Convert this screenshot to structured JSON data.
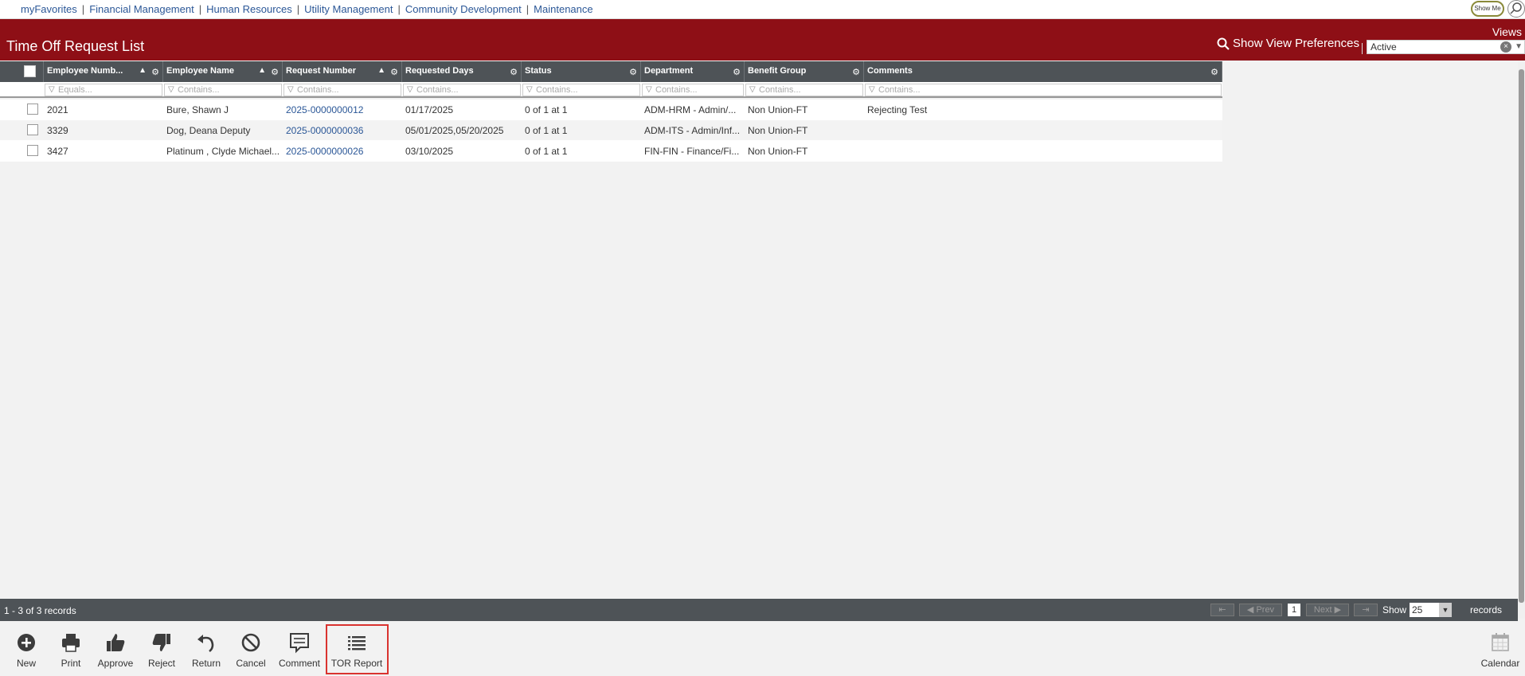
{
  "topnav": {
    "links": [
      "myFavorites",
      "Financial Management",
      "Human Resources",
      "Utility Management",
      "Community Development",
      "Maintenance"
    ],
    "show_me": "Show Me"
  },
  "titlebar": {
    "title": "Time Off Request List",
    "show_view_preferences": "Show View Preferences",
    "views_label": "Views",
    "view_value": "Active"
  },
  "grid": {
    "columns": [
      "Employee Numb...",
      "Employee Name",
      "Request Number",
      "Requested Days",
      "Status",
      "Department",
      "Benefit Group",
      "Comments"
    ],
    "filters": [
      "Equals...",
      "Contains...",
      "Contains...",
      "Contains...",
      "Contains...",
      "Contains...",
      "Contains...",
      "Contains..."
    ],
    "rows": [
      {
        "emp_no": "2021",
        "name": "Bure, Shawn J",
        "req_no": "2025-0000000012",
        "days": "01/17/2025",
        "status": "0 of 1 at 1",
        "dept": "ADM-HRM - Admin/...",
        "benefit": "Non Union-FT",
        "comments": "Rejecting Test"
      },
      {
        "emp_no": "3329",
        "name": "Dog, Deana Deputy",
        "req_no": "2025-0000000036",
        "days": "05/01/2025,05/20/2025",
        "status": "0 of 1 at 1",
        "dept": "ADM-ITS - Admin/Inf...",
        "benefit": "Non Union-FT",
        "comments": ""
      },
      {
        "emp_no": "3427",
        "name": "Platinum , Clyde Michael...",
        "req_no": "2025-0000000026",
        "days": "03/10/2025",
        "status": "0 of 1 at 1",
        "dept": "FIN-FIN - Finance/Fi...",
        "benefit": "Non Union-FT",
        "comments": ""
      }
    ]
  },
  "pager": {
    "count_text": "1 - 3 of 3 records",
    "prev": "Prev",
    "next": "Next",
    "page": "1",
    "show": "Show",
    "page_size": "25",
    "records": "records"
  },
  "toolbar": {
    "new": "New",
    "print": "Print",
    "approve": "Approve",
    "reject": "Reject",
    "return": "Return",
    "cancel": "Cancel",
    "comment": "Comment",
    "tor_report": "TOR Report",
    "calendar": "Calendar"
  }
}
